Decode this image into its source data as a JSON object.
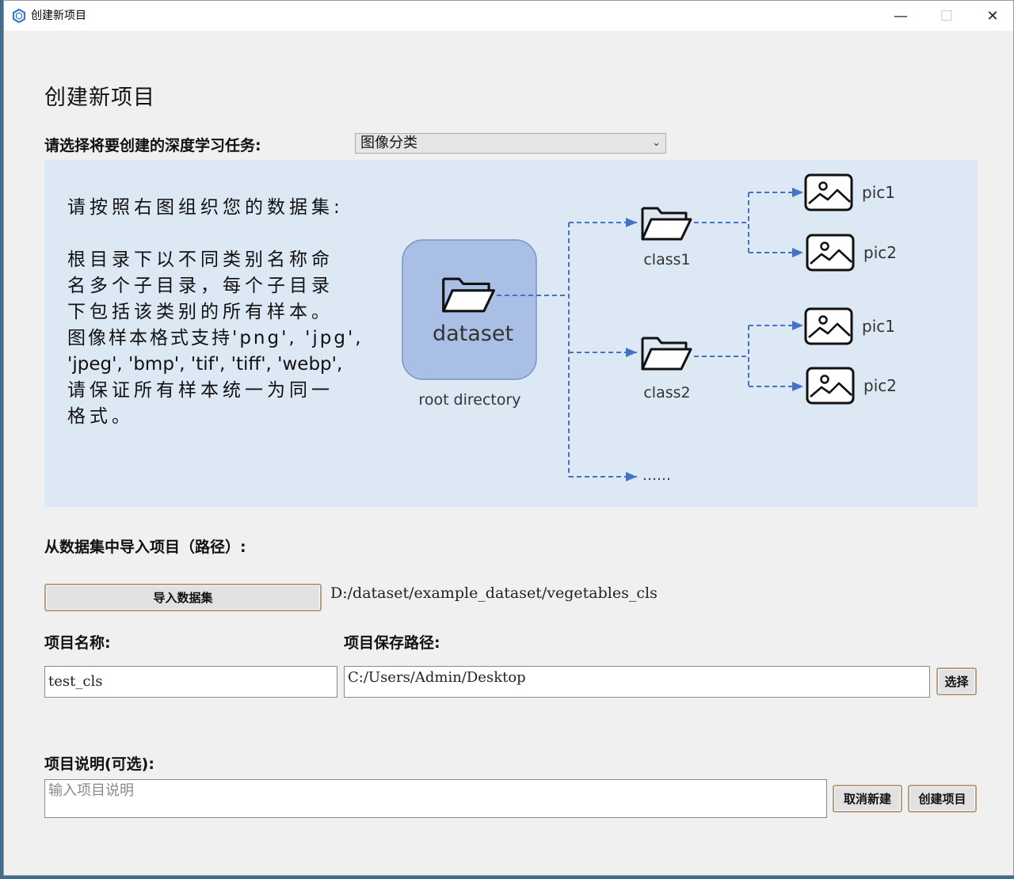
{
  "window": {
    "title": "创建新项目",
    "controls": {
      "minimize": "—",
      "maximize": "☐",
      "close": "✕"
    }
  },
  "page": {
    "title": "创建新项目"
  },
  "task": {
    "label": "请选择将要创建的深度学习任务:",
    "selected": "图像分类"
  },
  "instructions": {
    "line1": "请按照右图组织您的数据集:",
    "line2": "根目录下以不同类别名称命",
    "line3": "名多个子目录，每个子目录",
    "line4": "下包括该类别的所有样本。",
    "line5": "图像样本格式支持'png', 'jpg',",
    "line6": "'jpeg', 'bmp', 'tif', 'tiff', 'webp',",
    "line7": "请保证所有样本统一为同一",
    "line8": "格式。"
  },
  "diagram": {
    "root_label": "dataset",
    "root_caption": "root directory",
    "class1": "class1",
    "class2": "class2",
    "pic1": "pic1",
    "pic2": "pic2",
    "more": "……",
    "accent_color": "#4472c4",
    "root_fill": "#a9bfe5"
  },
  "import": {
    "label": "从数据集中导入项目（路径）:",
    "button": "导入数据集",
    "path": "D:/dataset/example_dataset/vegetables_cls"
  },
  "project": {
    "name_label": "项目名称:",
    "name_value": "test_cls",
    "save_label": "项目保存路径:",
    "save_value": "C:/Users/Admin/Desktop",
    "choose_button": "选择"
  },
  "description": {
    "label": "项目说明(可选):",
    "placeholder": "输入项目说明"
  },
  "actions": {
    "cancel": "取消新建",
    "create": "创建项目"
  }
}
